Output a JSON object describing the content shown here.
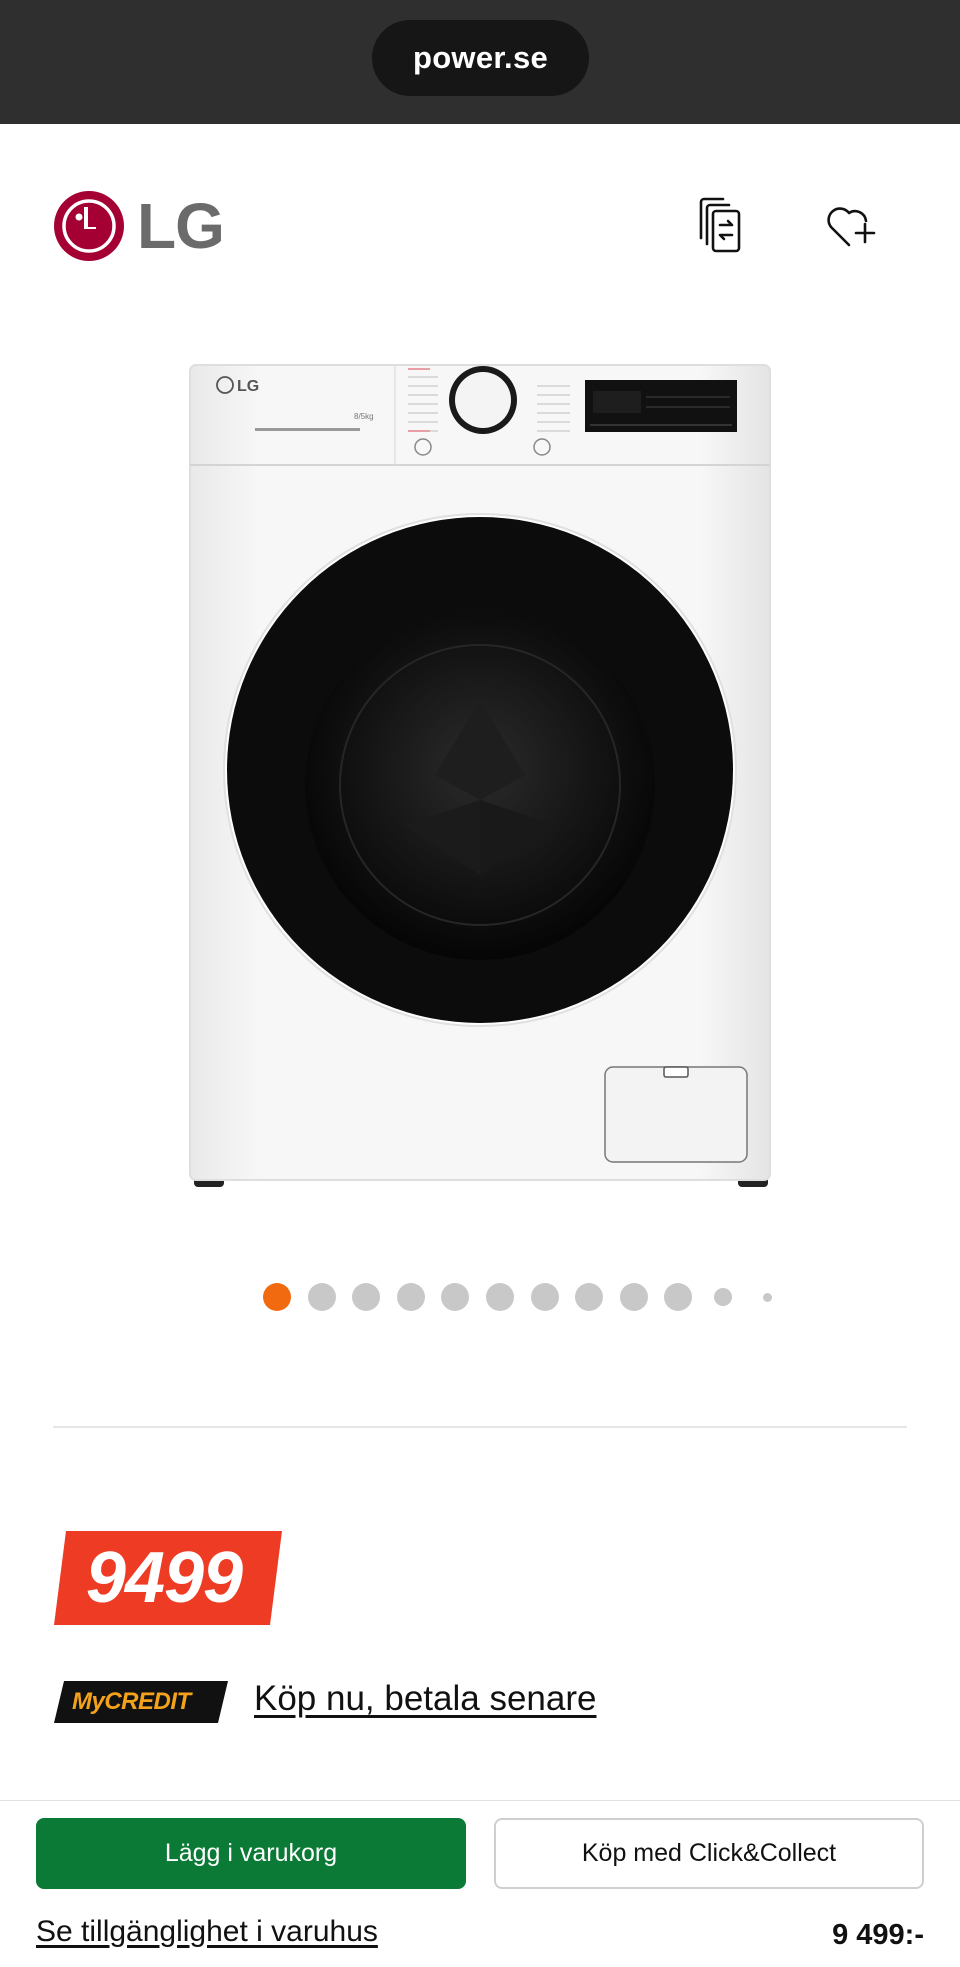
{
  "browser": {
    "url": "power.se"
  },
  "header": {
    "brand": "LG",
    "compare_icon": "compare-icon",
    "wishlist_icon": "heart-plus-icon"
  },
  "product": {
    "image_icon": "washing-machine-image",
    "carousel": {
      "total": 12,
      "active_index": 0
    },
    "price_badge": "9499",
    "credit": {
      "logo_text": "MyCREDIT",
      "link": "Köp nu, betala senare"
    }
  },
  "bottom_bar": {
    "add_to_cart": "Lägg i varukorg",
    "click_collect": "Köp med Click&Collect",
    "store_link": "Se tillgänglighet i varuhus",
    "price": "9 499:-"
  },
  "colors": {
    "accent_orange": "#f26a10",
    "price_red": "#ee3b24",
    "cart_green": "#0a7a36",
    "lg_red": "#a50034",
    "mycredit_yellow": "#f3a21a"
  }
}
